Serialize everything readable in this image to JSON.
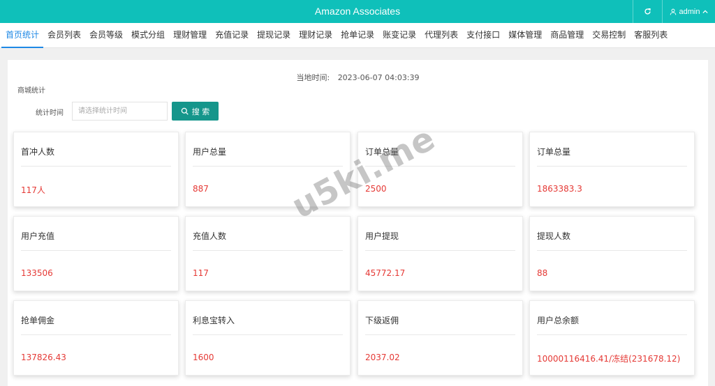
{
  "app": {
    "title": "Amazon Associates",
    "user": "admin",
    "accent": "#0fc0ba"
  },
  "tabs": [
    {
      "label": "首页统计",
      "active": true
    },
    {
      "label": "会员列表"
    },
    {
      "label": "会员等级"
    },
    {
      "label": "模式分组"
    },
    {
      "label": "理财管理"
    },
    {
      "label": "充值记录"
    },
    {
      "label": "提现记录"
    },
    {
      "label": "理财记录"
    },
    {
      "label": "抢单记录"
    },
    {
      "label": "账变记录"
    },
    {
      "label": "代理列表"
    },
    {
      "label": "支付接口"
    },
    {
      "label": "媒体管理"
    },
    {
      "label": "商品管理"
    },
    {
      "label": "交易控制"
    },
    {
      "label": "客服列表"
    }
  ],
  "local_time": {
    "label": "当地时间:",
    "value": "2023-06-07 04:03:39"
  },
  "section_title": "商城统计",
  "filter": {
    "label": "统计时间",
    "placeholder": "请选择统计时间",
    "value": "",
    "search_label": "搜 索"
  },
  "cards": [
    {
      "title": "首冲人数",
      "value": "117人"
    },
    {
      "title": "用户总量",
      "value": "887"
    },
    {
      "title": "订单总量",
      "value": "2500"
    },
    {
      "title": "订单总量",
      "value": "1863383.3"
    },
    {
      "title": "用户充值",
      "value": "133506"
    },
    {
      "title": "充值人数",
      "value": "117"
    },
    {
      "title": "用户提现",
      "value": "45772.17"
    },
    {
      "title": "提现人数",
      "value": "88"
    },
    {
      "title": "抢单佣金",
      "value": "137826.43"
    },
    {
      "title": "利息宝转入",
      "value": "1600"
    },
    {
      "title": "下级返佣",
      "value": "2037.02"
    },
    {
      "title": "用户总余额",
      "value": "10000116416.41/冻结(231678.12)"
    }
  ],
  "colors": {
    "value_red": "#e53935",
    "search_button": "#15968b",
    "active_tab": "#1e88e5"
  },
  "watermark": "u5ki.me"
}
